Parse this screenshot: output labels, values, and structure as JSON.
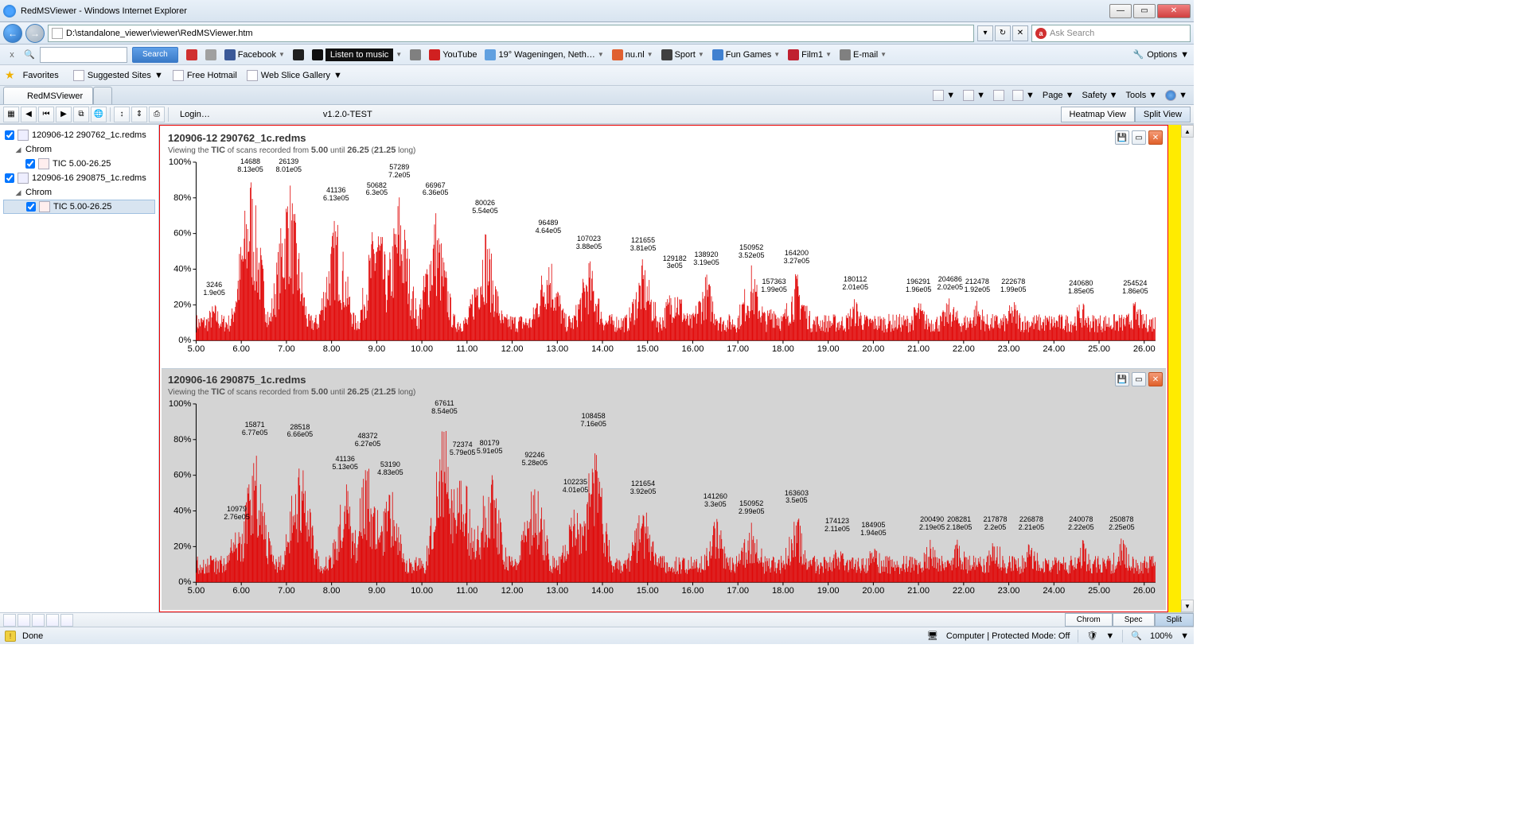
{
  "window": {
    "title": "RedMSViewer - Windows Internet Explorer",
    "min": "—",
    "max": "▭",
    "close": "✕"
  },
  "nav": {
    "back": "←",
    "forward": "→",
    "url": "D:\\standalone_viewer\\viewer\\RedMSViewer.htm",
    "refresh": "↻",
    "stop": "✕",
    "search_placeholder": "Ask Search"
  },
  "toolbar": {
    "x": "x",
    "search_btn": "Search",
    "links": [
      {
        "label": "",
        "icon": "#d03030"
      },
      {
        "label": "",
        "icon": "#a0a0a0"
      },
      {
        "label": "Facebook",
        "icon": "#3b5998",
        "drop": true
      },
      {
        "label": "",
        "icon": "#202020"
      },
      {
        "label": "Listen to music",
        "icon": "#101010",
        "drop": true,
        "dark": true
      },
      {
        "label": "",
        "icon": "#808080"
      },
      {
        "label": "YouTube",
        "icon": "#d02020"
      },
      {
        "label": "19° Wageningen, Neth…",
        "icon": "#60a0e0",
        "drop": true
      },
      {
        "label": "nu.nl",
        "icon": "#e06030",
        "drop": true
      },
      {
        "label": "Sport",
        "icon": "#404040",
        "drop": true
      },
      {
        "label": "Fun Games",
        "icon": "#4080d0",
        "drop": true
      },
      {
        "label": "Film1",
        "icon": "#c02030",
        "drop": true
      },
      {
        "label": "E-mail",
        "icon": "#808080",
        "drop": true
      }
    ],
    "options": "Options"
  },
  "favbar": {
    "favorites": "Favorites",
    "items": [
      {
        "label": "Suggested Sites",
        "drop": true
      },
      {
        "label": "Free Hotmail"
      },
      {
        "label": "Web Slice Gallery",
        "drop": true
      }
    ]
  },
  "tabs": {
    "active": "RedMSViewer"
  },
  "cmdbar": {
    "page": "Page",
    "safety": "Safety",
    "tools": "Tools"
  },
  "app_toolbar": {
    "login": "Login…",
    "version": "v1.2.0-TEST",
    "heatmap": "Heatmap View",
    "split": "Split View"
  },
  "tree": [
    {
      "type": "file",
      "checked": true,
      "label": "120906-12 290762_1c.redms"
    },
    {
      "type": "group",
      "label": "Chrom"
    },
    {
      "type": "tic",
      "checked": true,
      "label": "TIC 5.00-26.25"
    },
    {
      "type": "file",
      "checked": true,
      "label": "120906-16 290875_1c.redms"
    },
    {
      "type": "group",
      "label": "Chrom"
    },
    {
      "type": "tic",
      "checked": true,
      "label": "TIC 5.00-26.25",
      "sel": true
    }
  ],
  "charts": [
    {
      "title": "120906-12 290762_1c.redms",
      "sub_pre": "Viewing the ",
      "sub_b1": "TIC",
      "sub_mid": " of scans recorded from ",
      "sub_b2": "5.00",
      "sub_mid2": " until ",
      "sub_b3": "26.25",
      "sub_mid3": " (",
      "sub_b4": "21.25",
      "sub_end": " long)"
    },
    {
      "title": "120906-16 290875_1c.redms",
      "sub_pre": "Viewing the ",
      "sub_b1": "TIC",
      "sub_mid": " of scans recorded from ",
      "sub_b2": "5.00",
      "sub_mid2": " until ",
      "sub_b3": "26.25",
      "sub_mid3": " (",
      "sub_b4": "21.25",
      "sub_end": " long)"
    }
  ],
  "chart_data": [
    {
      "type": "line",
      "title": "120906-12 290762_1c.redms",
      "xlabel": "",
      "ylabel": "%",
      "xlim": [
        5,
        26.25
      ],
      "ylim": [
        0,
        100
      ],
      "y_ticks": [
        "0%",
        "20%",
        "40%",
        "60%",
        "80%",
        "100%"
      ],
      "x_ticks": [
        "5.00",
        "6.00",
        "7.00",
        "8.00",
        "9.00",
        "10.00",
        "11.00",
        "12.00",
        "13.00",
        "14.00",
        "15.00",
        "16.00",
        "17.00",
        "18.00",
        "19.00",
        "20.00",
        "21.00",
        "22.00",
        "23.00",
        "24.00",
        "25.00",
        "26.00"
      ],
      "peaks": [
        {
          "x": 5.4,
          "h": 22,
          "scan": "3246",
          "int": "1.9e05"
        },
        {
          "x": 6.2,
          "h": 100,
          "scan": "14688",
          "int": "8.13e05"
        },
        {
          "x": 7.05,
          "h": 99,
          "scan": "26139",
          "int": "8.01e05"
        },
        {
          "x": 8.1,
          "h": 75,
          "scan": "41136",
          "int": "6.13e05"
        },
        {
          "x": 9.0,
          "h": 78,
          "scan": "50682",
          "int": "6.3e05"
        },
        {
          "x": 9.5,
          "h": 88,
          "scan": "57289",
          "int": "7.2e05"
        },
        {
          "x": 10.3,
          "h": 78,
          "scan": "66967",
          "int": "6.36e05"
        },
        {
          "x": 11.4,
          "h": 68,
          "scan": "80026",
          "int": "5.54e05"
        },
        {
          "x": 12.8,
          "h": 57,
          "scan": "96489",
          "int": "4.64e05"
        },
        {
          "x": 13.7,
          "h": 48,
          "scan": "107023",
          "int": "3.88e05"
        },
        {
          "x": 14.9,
          "h": 47,
          "scan": "121655",
          "int": "3.81e05"
        },
        {
          "x": 15.6,
          "h": 37,
          "scan": "129182",
          "int": "3e05"
        },
        {
          "x": 16.3,
          "h": 39,
          "scan": "138920",
          "int": "3.19e05"
        },
        {
          "x": 17.3,
          "h": 43,
          "scan": "150952",
          "int": "3.52e05"
        },
        {
          "x": 17.8,
          "h": 24,
          "scan": "157363",
          "int": "1.99e05"
        },
        {
          "x": 18.3,
          "h": 40,
          "scan": "164200",
          "int": "3.27e05"
        },
        {
          "x": 19.6,
          "h": 25,
          "scan": "180112",
          "int": "2.01e05"
        },
        {
          "x": 21.0,
          "h": 24,
          "scan": "196291",
          "int": "1.96e05"
        },
        {
          "x": 21.7,
          "h": 25,
          "scan": "204686",
          "int": "2.02e05"
        },
        {
          "x": 22.3,
          "h": 24,
          "scan": "212478",
          "int": "1.92e05"
        },
        {
          "x": 23.1,
          "h": 24,
          "scan": "222678",
          "int": "1.99e05"
        },
        {
          "x": 24.6,
          "h": 23,
          "scan": "240680",
          "int": "1.85e05"
        },
        {
          "x": 25.8,
          "h": 23,
          "scan": "254524",
          "int": "1.86e05"
        }
      ]
    },
    {
      "type": "line",
      "title": "120906-16 290875_1c.redms",
      "xlabel": "",
      "ylabel": "%",
      "xlim": [
        5,
        26.25
      ],
      "ylim": [
        0,
        100
      ],
      "y_ticks": [
        "0%",
        "20%",
        "40%",
        "60%",
        "80%",
        "100%"
      ],
      "x_ticks": [
        "5.00",
        "6.00",
        "7.00",
        "8.00",
        "9.00",
        "10.00",
        "11.00",
        "12.00",
        "13.00",
        "14.00",
        "15.00",
        "16.00",
        "17.00",
        "18.00",
        "19.00",
        "20.00",
        "21.00",
        "22.00",
        "23.00",
        "24.00",
        "25.00",
        "26.00"
      ],
      "peaks": [
        {
          "x": 5.9,
          "h": 32,
          "scan": "10979",
          "int": "2.76e05"
        },
        {
          "x": 6.3,
          "h": 79,
          "scan": "15871",
          "int": "6.77e05"
        },
        {
          "x": 7.3,
          "h": 78,
          "scan": "28518",
          "int": "6.66e05"
        },
        {
          "x": 8.3,
          "h": 60,
          "scan": "41136",
          "int": "5.13e05"
        },
        {
          "x": 8.8,
          "h": 73,
          "scan": "48372",
          "int": "6.27e05"
        },
        {
          "x": 9.3,
          "h": 57,
          "scan": "53190",
          "int": "4.83e05"
        },
        {
          "x": 10.5,
          "h": 100,
          "scan": "67611",
          "int": "8.54e05"
        },
        {
          "x": 10.9,
          "h": 68,
          "scan": "72374",
          "int": "5.79e05"
        },
        {
          "x": 11.5,
          "h": 69,
          "scan": "80179",
          "int": "5.91e05"
        },
        {
          "x": 12.5,
          "h": 62,
          "scan": "92246",
          "int": "5.28e05"
        },
        {
          "x": 13.4,
          "h": 47,
          "scan": "102235",
          "int": "4.01e05"
        },
        {
          "x": 13.8,
          "h": 84,
          "scan": "108458",
          "int": "7.16e05"
        },
        {
          "x": 14.9,
          "h": 46,
          "scan": "121654",
          "int": "3.92e05"
        },
        {
          "x": 16.5,
          "h": 39,
          "scan": "141260",
          "int": "3.3e05"
        },
        {
          "x": 17.3,
          "h": 35,
          "scan": "150952",
          "int": "2.99e05"
        },
        {
          "x": 18.3,
          "h": 41,
          "scan": "163603",
          "int": "3.5e05"
        },
        {
          "x": 19.2,
          "h": 25,
          "scan": "174123",
          "int": "2.11e05"
        },
        {
          "x": 20.0,
          "h": 23,
          "scan": "184905",
          "int": "1.94e05"
        },
        {
          "x": 21.3,
          "h": 26,
          "scan": "200490",
          "int": "2.19e05"
        },
        {
          "x": 21.9,
          "h": 26,
          "scan": "208281",
          "int": "2.18e05"
        },
        {
          "x": 22.7,
          "h": 26,
          "scan": "217878",
          "int": "2.2e05"
        },
        {
          "x": 23.5,
          "h": 26,
          "scan": "226878",
          "int": "2.21e05"
        },
        {
          "x": 24.6,
          "h": 26,
          "scan": "240078",
          "int": "2.22e05"
        },
        {
          "x": 25.5,
          "h": 26,
          "scan": "250878",
          "int": "2.25e05"
        }
      ]
    }
  ],
  "footer": {
    "chrom": "Chrom",
    "spec": "Spec",
    "split": "Split"
  },
  "status": {
    "done": "Done",
    "mode": "Computer | Protected Mode: Off",
    "zoom": "100%"
  }
}
